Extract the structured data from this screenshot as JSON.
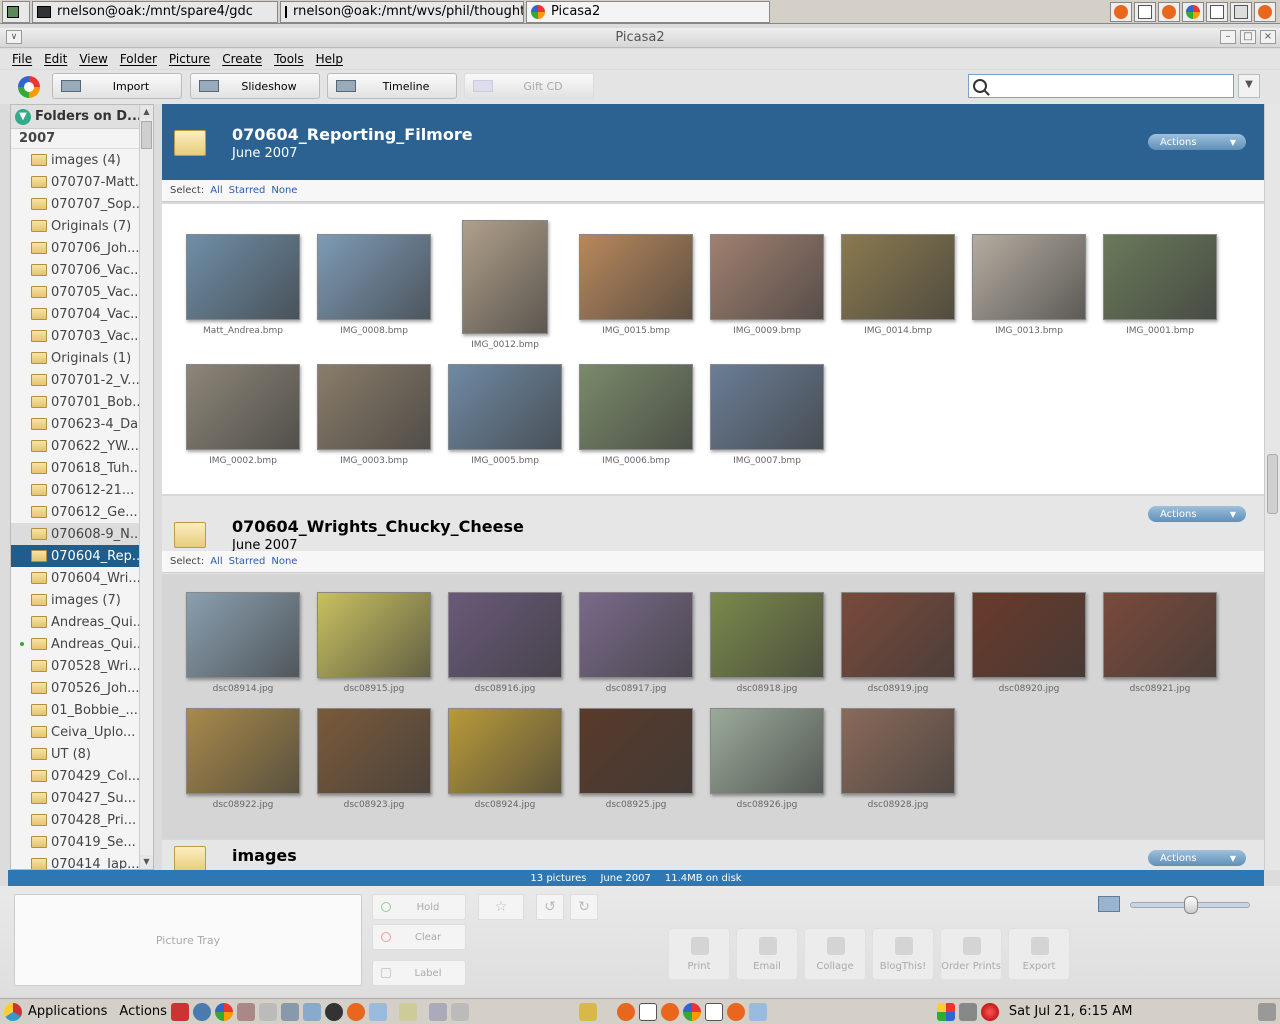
{
  "top_taskbar": {
    "tasks": [
      {
        "label": "rnelson@oak:/mnt/spare4/gdc"
      },
      {
        "label": "rnelson@oak:/mnt/wvs/phil/thoughtlet"
      },
      {
        "label": "Picasa2"
      }
    ]
  },
  "window": {
    "title": "Picasa2"
  },
  "menu": [
    "File",
    "Edit",
    "View",
    "Folder",
    "Picture",
    "Create",
    "Tools",
    "Help"
  ],
  "toolbar": {
    "import": "Import",
    "slideshow": "Slideshow",
    "timeline": "Timeline",
    "gift_cd": "Gift CD",
    "search_value": ""
  },
  "sidebar": {
    "header": "Folders on D...",
    "year": "2007",
    "items": [
      {
        "label": "images (4)"
      },
      {
        "label": "070707-Matt..."
      },
      {
        "label": "070707_Sop..."
      },
      {
        "label": "Originals (7)"
      },
      {
        "label": "070706_Joh..."
      },
      {
        "label": "070706_Vac..."
      },
      {
        "label": "070705_Vac..."
      },
      {
        "label": "070704_Vac..."
      },
      {
        "label": "070703_Vac..."
      },
      {
        "label": "Originals (1)"
      },
      {
        "label": "070701-2_V..."
      },
      {
        "label": "070701_Bob..."
      },
      {
        "label": "070623-4_Da..."
      },
      {
        "label": "070622_YW..."
      },
      {
        "label": "070618_Tuh..."
      },
      {
        "label": "070612-21..."
      },
      {
        "label": "070612_Ge..."
      },
      {
        "label": "070608-9_N..."
      },
      {
        "label": "070604_Rep..."
      },
      {
        "label": "070604_Wri..."
      },
      {
        "label": "images (7)"
      },
      {
        "label": "Andreas_Qui..."
      },
      {
        "label": "Andreas_Qui..."
      },
      {
        "label": "070528_Wri..."
      },
      {
        "label": "070526_Joh..."
      },
      {
        "label": "01_Bobbie_..."
      },
      {
        "label": "Ceiva_Uplo..."
      },
      {
        "label": "UT (8)"
      },
      {
        "label": "070429_Col..."
      },
      {
        "label": "070427_Su..."
      },
      {
        "label": "070428_Pri..."
      },
      {
        "label": "070419_Se..."
      },
      {
        "label": "070414_Iap..."
      }
    ]
  },
  "sections": [
    {
      "title": "070604_Reporting_Filmore",
      "date": "June 2007",
      "actions": "Actions",
      "select": {
        "label": "Select:",
        "all": "All",
        "starred": "Starred",
        "none": "None"
      },
      "photos": [
        {
          "caption": "Matt_Andrea.bmp",
          "color": "#6f8fa8"
        },
        {
          "caption": "IMG_0008.bmp",
          "color": "#7d9bb6"
        },
        {
          "caption": "IMG_0012.bmp",
          "color": "#b0a08a"
        },
        {
          "caption": "IMG_0015.bmp",
          "color": "#b8885a"
        },
        {
          "caption": "IMG_0009.bmp",
          "color": "#a08070"
        },
        {
          "caption": "IMG_0014.bmp",
          "color": "#8a7a4e"
        },
        {
          "caption": "IMG_0013.bmp",
          "color": "#b4aca0"
        },
        {
          "caption": "IMG_0001.bmp",
          "color": "#6a7a5a"
        },
        {
          "caption": "IMG_0002.bmp",
          "color": "#8d8678"
        },
        {
          "caption": "IMG_0003.bmp",
          "color": "#8a7d6a"
        },
        {
          "caption": "IMG_0005.bmp",
          "color": "#6f8aa4"
        },
        {
          "caption": "IMG_0006.bmp",
          "color": "#7a8a6a"
        },
        {
          "caption": "IMG_0007.bmp",
          "color": "#6a7e96"
        }
      ]
    },
    {
      "title": "070604_Wrights_Chucky_Cheese",
      "date": "June 2007",
      "actions": "Actions",
      "select": {
        "label": "Select:",
        "all": "All",
        "starred": "Starred",
        "none": "None"
      },
      "photos": [
        {
          "caption": "dsc08914.jpg",
          "color": "#8aa0b0"
        },
        {
          "caption": "dsc08915.jpg",
          "color": "#c8c060"
        },
        {
          "caption": "dsc08916.jpg",
          "color": "#6a5a7a"
        },
        {
          "caption": "dsc08917.jpg",
          "color": "#7a6a8a"
        },
        {
          "caption": "dsc08918.jpg",
          "color": "#7a8a4a"
        },
        {
          "caption": "dsc08919.jpg",
          "color": "#7a4a3a"
        },
        {
          "caption": "dsc08920.jpg",
          "color": "#6a3a2a"
        },
        {
          "caption": "dsc08921.jpg",
          "color": "#7a4a3a"
        },
        {
          "caption": "dsc08922.jpg",
          "color": "#a88a4a"
        },
        {
          "caption": "dsc08923.jpg",
          "color": "#7a5a3a"
        },
        {
          "caption": "dsc08924.jpg",
          "color": "#b89a3a"
        },
        {
          "caption": "dsc08925.jpg",
          "color": "#5a3a2a"
        },
        {
          "caption": "dsc08926.jpg",
          "color": "#9aaa9a"
        },
        {
          "caption": "dsc08928.jpg",
          "color": "#8a6a5a"
        }
      ]
    },
    {
      "title": "images",
      "actions": "Actions"
    }
  ],
  "status": {
    "count": "13 pictures",
    "date": "June 2007",
    "size": "11.4MB on disk"
  },
  "bottom": {
    "picture_tray": "Picture Tray",
    "hold": "Hold",
    "clear": "Clear",
    "label": "Label",
    "export_buttons": [
      "Print",
      "Email",
      "Collage",
      "BlogThis!",
      "Order Prints",
      "Export"
    ]
  },
  "bottom_taskbar": {
    "applications": "Applications",
    "actions": "Actions",
    "clock": "Sat Jul 21,  6:15 AM"
  }
}
